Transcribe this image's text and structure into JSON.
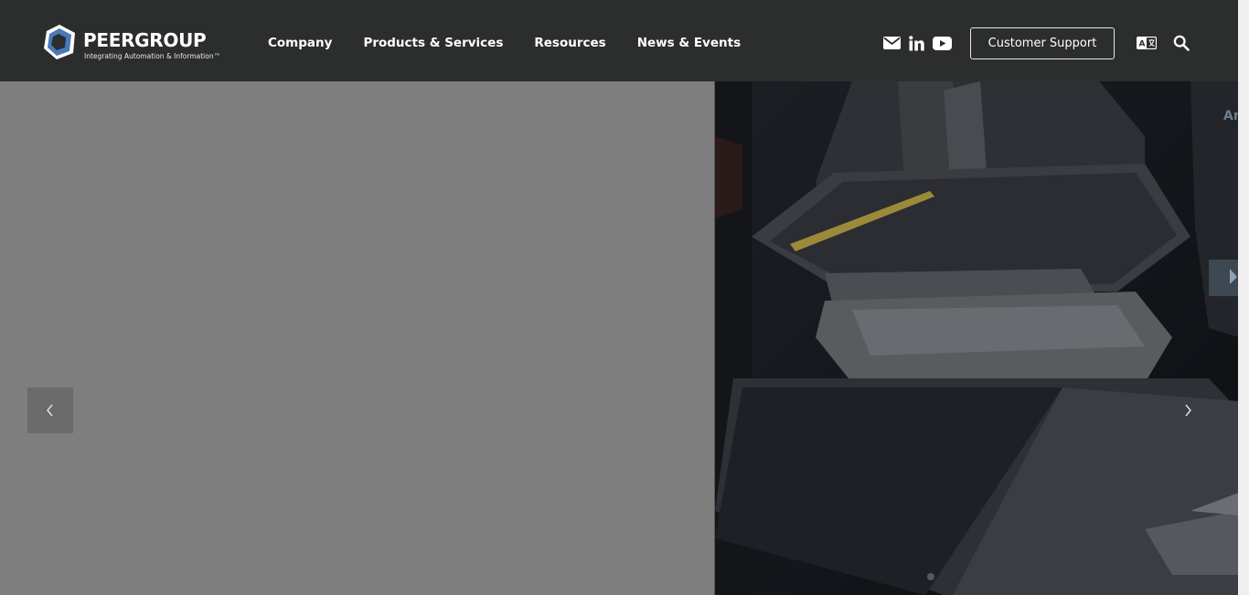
{
  "brand": {
    "name": "PEERGROUP",
    "tagline": "Integrating Automation & Information™"
  },
  "nav": {
    "items": [
      {
        "label": "Company"
      },
      {
        "label": "Products & Services"
      },
      {
        "label": "Resources"
      },
      {
        "label": "News & Events"
      }
    ]
  },
  "header": {
    "social": [
      "email-icon",
      "linkedin-icon",
      "youtube-icon"
    ],
    "support_label": "Customer Support",
    "translate_icon": "translate-icon",
    "search_icon": "search-icon"
  },
  "hero": {
    "prev_icon": "chevron-left-icon",
    "next_icon": "chevron-right-icon"
  },
  "colors": {
    "header_bg": "#2c2d2d",
    "hero_left_bg": "#7e7e7e",
    "hero_right_bg": "#111317",
    "text": "#ffffff",
    "logo_blue": "#4a79b8"
  }
}
